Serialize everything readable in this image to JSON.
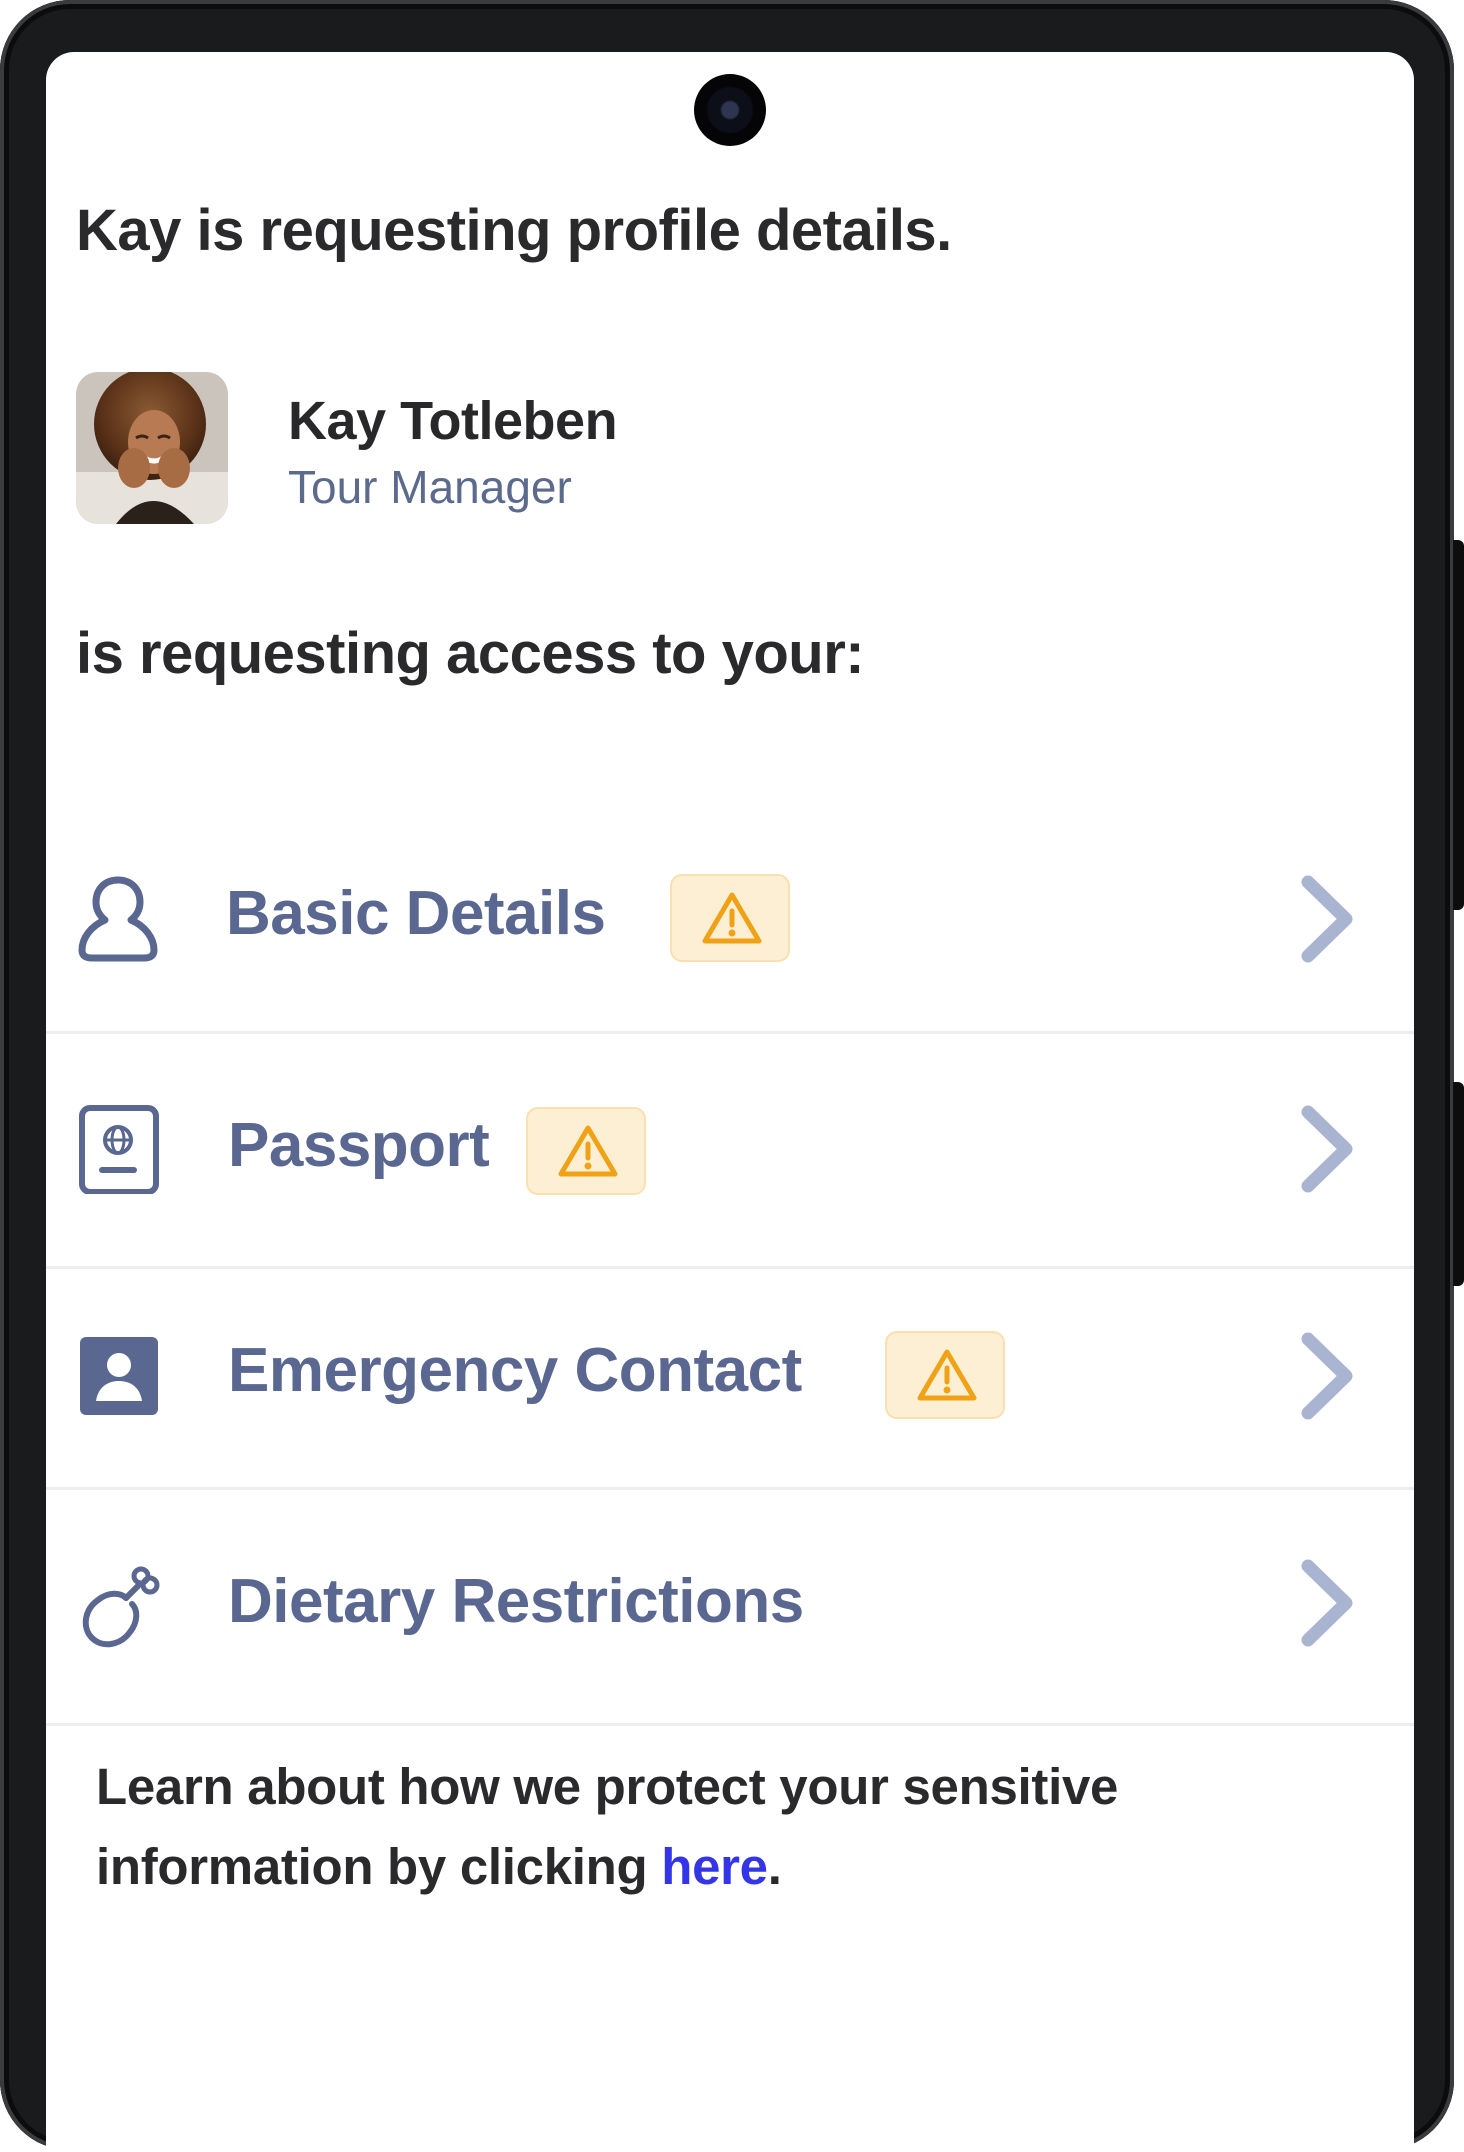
{
  "request": {
    "heading": "Kay is requesting profile details.",
    "requester": {
      "name": "Kay Totleben",
      "role": "Tour Manager"
    },
    "subheading": "is requesting access to your:"
  },
  "access_items": [
    {
      "label": "Basic Details",
      "icon": "user-icon",
      "warning": true
    },
    {
      "label": "Passport",
      "icon": "passport-icon",
      "warning": true
    },
    {
      "label": "Emergency Contact",
      "icon": "contact-card-icon",
      "warning": true
    },
    {
      "label": "Dietary Restrictions",
      "icon": "drumstick-icon",
      "warning": false
    }
  ],
  "footer": {
    "text_before": "Learn about how we protect your sensitive information by clicking ",
    "link_label": "here",
    "text_after": "."
  },
  "colors": {
    "item_text": "#5a6790",
    "chevron": "#a9b4d0",
    "warning_icon": "#f0a216",
    "warning_bg": "#fdefd4",
    "link": "#3535e8"
  }
}
